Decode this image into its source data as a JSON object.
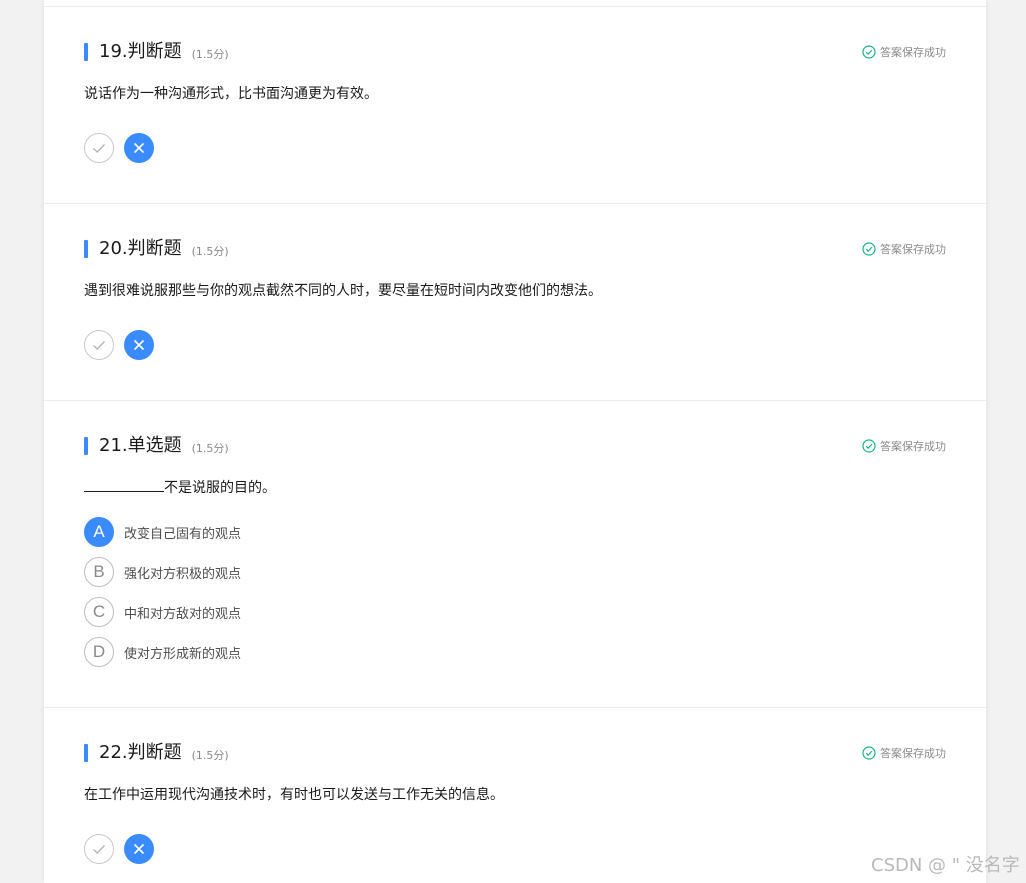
{
  "colors": {
    "accent": "#3a8bff",
    "status_green": "#19b37a",
    "divider": "#ececec",
    "background": "#f2f2f2"
  },
  "questions": [
    {
      "title": "19.判断题",
      "score": "(1.5分)",
      "status": "答案保存成功",
      "status_icon": "check-circle-icon",
      "text": "说话作为一种沟通形式，比书面沟通更为有效。",
      "type": "true-false",
      "selected": "false"
    },
    {
      "title": "20.判断题",
      "score": "(1.5分)",
      "status": "答案保存成功",
      "status_icon": "check-circle-icon",
      "text": "遇到很难说服那些与你的观点截然不同的人时，要尽量在短时间内改变他们的想法。",
      "type": "true-false",
      "selected": "false"
    },
    {
      "title": "21.单选题",
      "score": "(1.5分)",
      "status": "答案保存成功",
      "status_icon": "check-circle-icon",
      "text": "不是说服的目的。",
      "type": "single-choice",
      "selected": "A",
      "options": [
        {
          "letter": "A",
          "text": "改变自己固有的观点"
        },
        {
          "letter": "B",
          "text": "强化对方积极的观点"
        },
        {
          "letter": "C",
          "text": "中和对方敌对的观点"
        },
        {
          "letter": "D",
          "text": "使对方形成新的观点"
        }
      ]
    },
    {
      "title": "22.判断题",
      "score": "(1.5分)",
      "status": "答案保存成功",
      "status_icon": "check-circle-icon",
      "text": "在工作中运用现代沟通技术时，有时也可以发送与工作无关的信息。",
      "type": "true-false",
      "selected": "false"
    }
  ],
  "watermark": "CSDN @ \" 没名字"
}
